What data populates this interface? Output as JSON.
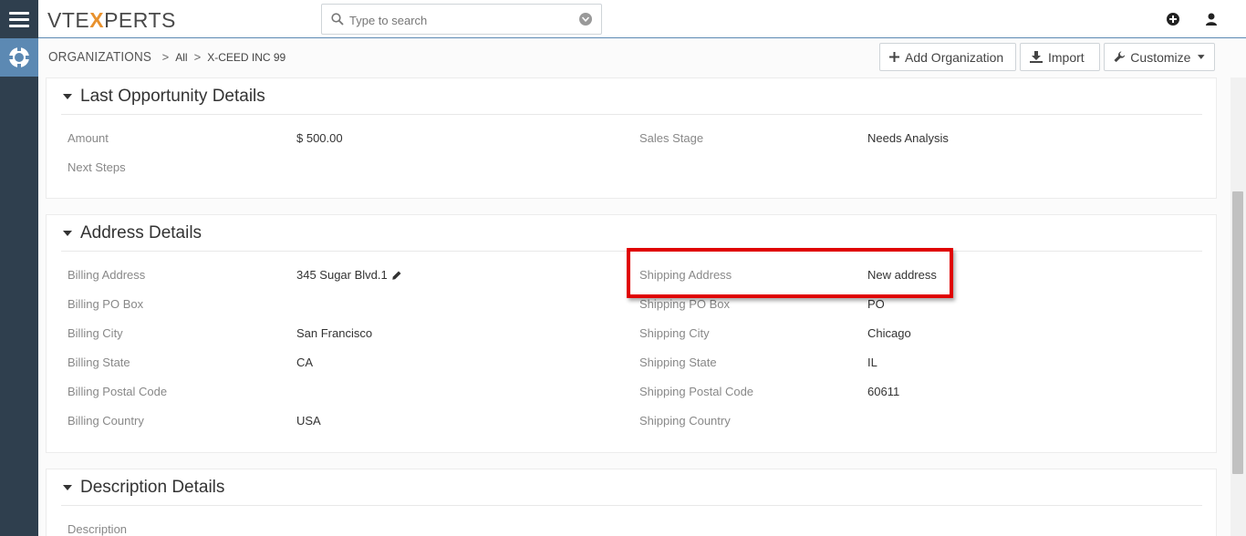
{
  "app": {
    "logo_prefix": "VTE",
    "logo_x": "X",
    "logo_suffix": "PERTS"
  },
  "search": {
    "placeholder": "Type to search"
  },
  "breadcrumb": {
    "module": "ORGANIZATIONS",
    "filter": "All",
    "record": "X-CEED INC 99"
  },
  "toolbar": {
    "add_label": "Add Organization",
    "import_label": "Import",
    "customize_label": "Customize"
  },
  "icons": {
    "menu": "hamburger-icon",
    "module": "lifebuoy-icon",
    "add": "plus-circle-icon",
    "user": "user-icon",
    "search": "search-icon",
    "dropdown": "chevron-down-circle-icon",
    "edit": "pencil-icon"
  },
  "colors": {
    "rail": "#2f3f4e",
    "accent": "#5c89b3",
    "highlight": "#e00000",
    "logo_x": "#e8912d"
  },
  "sections": {
    "last_opportunity": {
      "title": "Last Opportunity Details",
      "fields": [
        {
          "label": "Amount",
          "value": "$ 500.00"
        },
        {
          "label": "Sales Stage",
          "value": "Needs Analysis"
        },
        {
          "label": "Next Steps",
          "value": ""
        }
      ]
    },
    "address": {
      "title": "Address Details",
      "billing": [
        {
          "label": "Billing Address",
          "value": "345 Sugar Blvd.1"
        },
        {
          "label": "Billing PO Box",
          "value": ""
        },
        {
          "label": "Billing City",
          "value": "San Francisco"
        },
        {
          "label": "Billing State",
          "value": "CA"
        },
        {
          "label": "Billing Postal Code",
          "value": ""
        },
        {
          "label": "Billing Country",
          "value": "USA"
        }
      ],
      "shipping": [
        {
          "label": "Shipping Address",
          "value": "New address"
        },
        {
          "label": "Shipping PO Box",
          "value": "PO"
        },
        {
          "label": "Shipping City",
          "value": "Chicago"
        },
        {
          "label": "Shipping State",
          "value": "IL"
        },
        {
          "label": "Shipping Postal Code",
          "value": "60611"
        },
        {
          "label": "Shipping Country",
          "value": ""
        }
      ]
    },
    "description": {
      "title": "Description Details",
      "fields": [
        {
          "label": "Description",
          "value": ""
        }
      ]
    }
  }
}
